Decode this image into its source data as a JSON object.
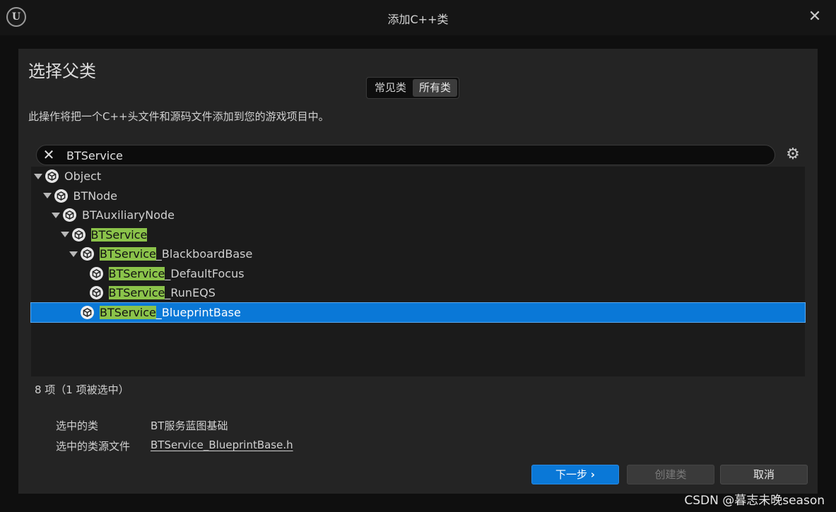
{
  "window": {
    "title": "添加C++类",
    "logo_icon": "unreal-engine-logo",
    "close_label": "✕"
  },
  "page": {
    "heading": "选择父类",
    "tabs": [
      {
        "label": "常见类",
        "active": false
      },
      {
        "label": "所有类",
        "active": true
      }
    ],
    "description": "此操作将把一个C++头文件和源码文件添加到您的游戏项目中。"
  },
  "search": {
    "value": "BTService",
    "clear_icon": "close-icon",
    "settings_icon": "gear-icon"
  },
  "tree": {
    "highlight_color": "#8bc34a",
    "items": [
      {
        "prefix": "",
        "match": "",
        "suffix": "Object",
        "depth": 0,
        "expandable": true,
        "selected": false
      },
      {
        "prefix": "",
        "match": "",
        "suffix": "BTNode",
        "depth": 1,
        "expandable": true,
        "selected": false
      },
      {
        "prefix": "",
        "match": "",
        "suffix": "BTAuxiliaryNode",
        "depth": 2,
        "expandable": true,
        "selected": false
      },
      {
        "prefix": "",
        "match": "BTService",
        "suffix": "",
        "depth": 3,
        "expandable": true,
        "selected": false
      },
      {
        "prefix": "",
        "match": "BTService",
        "suffix": "_BlackboardBase",
        "depth": 4,
        "expandable": true,
        "selected": false
      },
      {
        "prefix": "",
        "match": "BTService",
        "suffix": "_DefaultFocus",
        "depth": 5,
        "expandable": false,
        "selected": false
      },
      {
        "prefix": "",
        "match": "BTService",
        "suffix": "_RunEQS",
        "depth": 5,
        "expandable": false,
        "selected": false
      },
      {
        "prefix": "",
        "match": "BTService",
        "suffix": "_BlueprintBase",
        "depth": 4,
        "expandable": false,
        "selected": true
      }
    ]
  },
  "status": {
    "count_text": "8 项（1 项被选中）"
  },
  "info": {
    "selected_class_label": "选中的类",
    "selected_class_value": "BT服务蓝图基础",
    "source_file_label": "选中的类源文件",
    "source_file_value": "BTService_BlueprintBase.h"
  },
  "buttons": {
    "next_label": "下一步",
    "next_icon": "chevron-right-icon",
    "create_label": "创建类",
    "cancel_label": "取消"
  },
  "watermark": "CSDN @暮志未晚season",
  "colors": {
    "accent": "#0a78d7",
    "highlight": "#8bc34a"
  }
}
